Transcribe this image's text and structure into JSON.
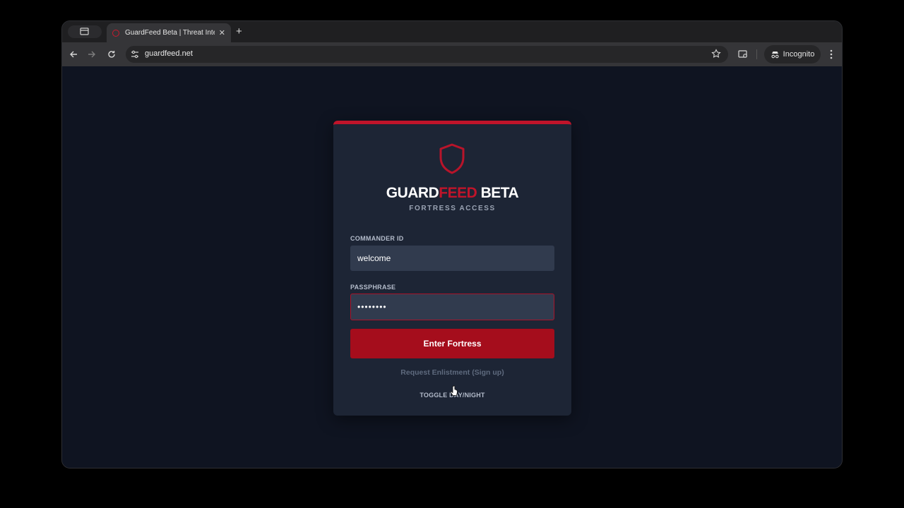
{
  "browser": {
    "tab_title": "GuardFeed Beta | Threat Intel",
    "url": "guardfeed.net",
    "incognito_label": "Incognito",
    "new_tab_symbol": "+",
    "tab_close_symbol": "✕"
  },
  "login": {
    "brand_prefix": "GUARD",
    "brand_accent": "FEED",
    "brand_suffix": " BETA",
    "subtitle": "FORTRESS ACCESS",
    "commander_label": "COMMANDER ID",
    "commander_value": "welcome",
    "passphrase_label": "PASSPHRASE",
    "passphrase_value": "••••••••",
    "submit_label": "Enter Fortress",
    "signup_link": "Request Enlistment (Sign up)",
    "toggle_label": "TOGGLE DAY/NIGHT"
  },
  "colors": {
    "accent": "#c0142a",
    "button": "#a50d1c",
    "card": "#1d2535",
    "page_bg": "#0f1421",
    "input_bg": "#313b4e"
  }
}
